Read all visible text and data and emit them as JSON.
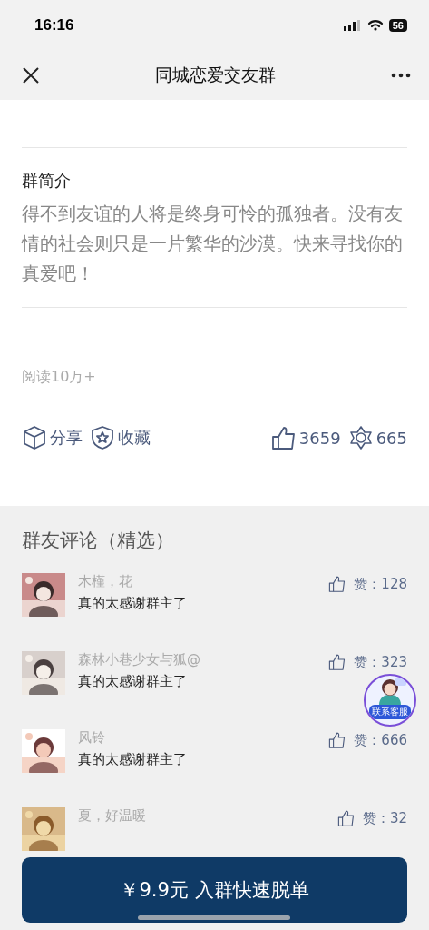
{
  "status_bar": {
    "time": "16:16",
    "battery": "56"
  },
  "nav": {
    "title": "同城恋爱交友群"
  },
  "intro": {
    "heading": "群简介",
    "text": "得不到友谊的人将是终身可怜的孤独者。没有友情的社会则只是一片繁华的沙漠。快来寻找你的真爱吧！"
  },
  "reads": "阅读10万+",
  "actions": [
    {
      "kind": "share",
      "label": "分享"
    },
    {
      "kind": "favorite",
      "label": "收藏"
    },
    {
      "kind": "like",
      "label": "3659"
    },
    {
      "kind": "star",
      "label": "665"
    }
  ],
  "comments_heading": "群友评论（精选）",
  "comments": [
    {
      "name": "木槿，花",
      "text": "真的太感谢群主了",
      "likes": "赞：128"
    },
    {
      "name": "森林小巷少女与狐@",
      "text": "真的太感谢群主了",
      "likes": "赞：323"
    },
    {
      "name": "风铃",
      "text": "真的太感谢群主了",
      "likes": "赞：666"
    },
    {
      "name": "夏，好温暖",
      "likes": "赞：32"
    }
  ],
  "service_badge": "联系客服",
  "join_button": "￥9.9元 入群快速脱单"
}
